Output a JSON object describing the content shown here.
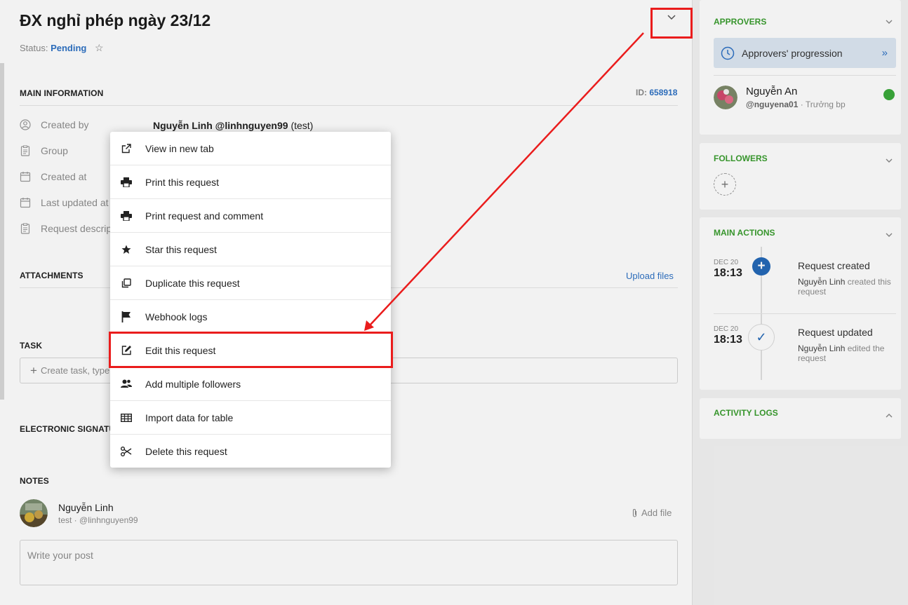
{
  "header": {
    "title": "ĐX nghỉ phép ngày 23/12",
    "status_label": "Status:",
    "status_value": "Pending"
  },
  "main_info": {
    "heading": "MAIN INFORMATION",
    "id_label": "ID:",
    "id_value": "658918",
    "rows": [
      {
        "label": "Created by",
        "icon": "user-icon"
      },
      {
        "label": "Group",
        "icon": "clipboard-icon"
      },
      {
        "label": "Created at",
        "icon": "calendar-icon"
      },
      {
        "label": "Last updated at",
        "icon": "calendar-icon"
      },
      {
        "label": "Request descrip",
        "icon": "clipboard-icon"
      }
    ],
    "creator_name": "Nguyễn Linh @linhnguyen99",
    "creator_suffix": " (test)"
  },
  "attachments": {
    "heading": "ATTACHMENTS",
    "upload_label": "Upload files"
  },
  "task": {
    "heading": "TASK",
    "placeholder": "Create task, type"
  },
  "esign": {
    "heading": "ELECTRONIC SIGNATUR"
  },
  "notes": {
    "heading": "NOTES",
    "user_name": "Nguyễn Linh",
    "user_sub": "test · @linhnguyen99",
    "add_file": "Add file",
    "post_placeholder": "Write your post"
  },
  "menu": {
    "items": [
      {
        "label": "View in new tab",
        "icon": "external-link-icon"
      },
      {
        "label": "Print this request",
        "icon": "printer-icon"
      },
      {
        "label": "Print request and comment",
        "icon": "printer-icon"
      },
      {
        "label": "Star this request",
        "icon": "star-icon"
      },
      {
        "label": "Duplicate this request",
        "icon": "copy-icon"
      },
      {
        "label": "Webhook logs",
        "icon": "flag-icon"
      },
      {
        "label": "Edit this request",
        "icon": "edit-icon"
      },
      {
        "label": "Add multiple followers",
        "icon": "users-icon"
      },
      {
        "label": "Import data for table",
        "icon": "table-icon"
      },
      {
        "label": "Delete this request",
        "icon": "scissors-icon"
      }
    ]
  },
  "sidebar": {
    "approvers": {
      "heading": "APPROVERS",
      "progress_label": "Approvers' progression",
      "approver_name": "Nguyễn An",
      "approver_handle": "@nguyena01",
      "approver_role": " · Trưởng bp"
    },
    "followers": {
      "heading": "FOLLOWERS"
    },
    "main_actions": {
      "heading": "MAIN ACTIONS",
      "events": [
        {
          "date": "DEC 20",
          "time": "18:13",
          "title": "Request created",
          "actor": "Nguyễn Linh",
          "desc": " created this request"
        },
        {
          "date": "DEC 20",
          "time": "18:13",
          "title": "Request updated",
          "actor": "Nguyễn Linh",
          "desc": " edited the request"
        }
      ]
    },
    "activity_logs": {
      "heading": "ACTIVITY LOGS"
    }
  },
  "colors": {
    "accent_green": "#3a9d2f",
    "link_blue": "#2f72c4",
    "annotation_red": "#ea1c1c",
    "online_green": "#3caa3c"
  }
}
